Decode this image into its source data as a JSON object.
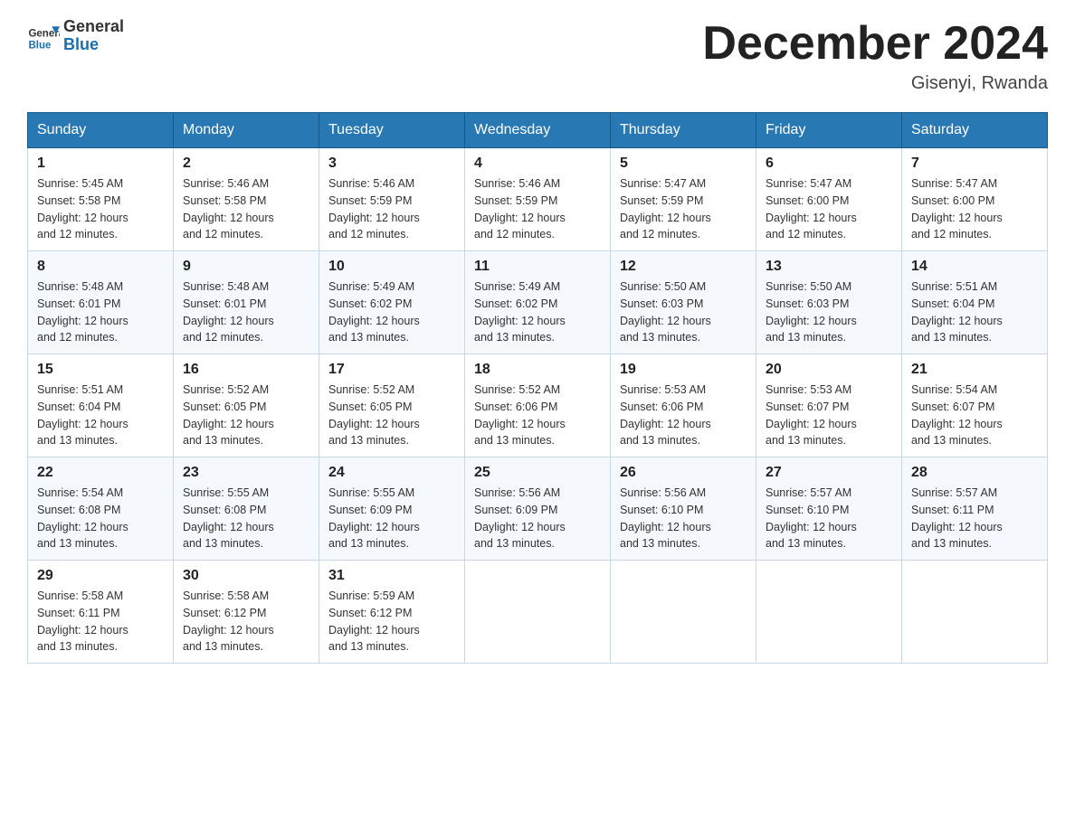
{
  "header": {
    "logo_general": "General",
    "logo_blue": "Blue",
    "month_title": "December 2024",
    "location": "Gisenyi, Rwanda"
  },
  "columns": [
    "Sunday",
    "Monday",
    "Tuesday",
    "Wednesday",
    "Thursday",
    "Friday",
    "Saturday"
  ],
  "weeks": [
    [
      {
        "day": "1",
        "info": "Sunrise: 5:45 AM\nSunset: 5:58 PM\nDaylight: 12 hours\nand 12 minutes."
      },
      {
        "day": "2",
        "info": "Sunrise: 5:46 AM\nSunset: 5:58 PM\nDaylight: 12 hours\nand 12 minutes."
      },
      {
        "day": "3",
        "info": "Sunrise: 5:46 AM\nSunset: 5:59 PM\nDaylight: 12 hours\nand 12 minutes."
      },
      {
        "day": "4",
        "info": "Sunrise: 5:46 AM\nSunset: 5:59 PM\nDaylight: 12 hours\nand 12 minutes."
      },
      {
        "day": "5",
        "info": "Sunrise: 5:47 AM\nSunset: 5:59 PM\nDaylight: 12 hours\nand 12 minutes."
      },
      {
        "day": "6",
        "info": "Sunrise: 5:47 AM\nSunset: 6:00 PM\nDaylight: 12 hours\nand 12 minutes."
      },
      {
        "day": "7",
        "info": "Sunrise: 5:47 AM\nSunset: 6:00 PM\nDaylight: 12 hours\nand 12 minutes."
      }
    ],
    [
      {
        "day": "8",
        "info": "Sunrise: 5:48 AM\nSunset: 6:01 PM\nDaylight: 12 hours\nand 12 minutes."
      },
      {
        "day": "9",
        "info": "Sunrise: 5:48 AM\nSunset: 6:01 PM\nDaylight: 12 hours\nand 12 minutes."
      },
      {
        "day": "10",
        "info": "Sunrise: 5:49 AM\nSunset: 6:02 PM\nDaylight: 12 hours\nand 13 minutes."
      },
      {
        "day": "11",
        "info": "Sunrise: 5:49 AM\nSunset: 6:02 PM\nDaylight: 12 hours\nand 13 minutes."
      },
      {
        "day": "12",
        "info": "Sunrise: 5:50 AM\nSunset: 6:03 PM\nDaylight: 12 hours\nand 13 minutes."
      },
      {
        "day": "13",
        "info": "Sunrise: 5:50 AM\nSunset: 6:03 PM\nDaylight: 12 hours\nand 13 minutes."
      },
      {
        "day": "14",
        "info": "Sunrise: 5:51 AM\nSunset: 6:04 PM\nDaylight: 12 hours\nand 13 minutes."
      }
    ],
    [
      {
        "day": "15",
        "info": "Sunrise: 5:51 AM\nSunset: 6:04 PM\nDaylight: 12 hours\nand 13 minutes."
      },
      {
        "day": "16",
        "info": "Sunrise: 5:52 AM\nSunset: 6:05 PM\nDaylight: 12 hours\nand 13 minutes."
      },
      {
        "day": "17",
        "info": "Sunrise: 5:52 AM\nSunset: 6:05 PM\nDaylight: 12 hours\nand 13 minutes."
      },
      {
        "day": "18",
        "info": "Sunrise: 5:52 AM\nSunset: 6:06 PM\nDaylight: 12 hours\nand 13 minutes."
      },
      {
        "day": "19",
        "info": "Sunrise: 5:53 AM\nSunset: 6:06 PM\nDaylight: 12 hours\nand 13 minutes."
      },
      {
        "day": "20",
        "info": "Sunrise: 5:53 AM\nSunset: 6:07 PM\nDaylight: 12 hours\nand 13 minutes."
      },
      {
        "day": "21",
        "info": "Sunrise: 5:54 AM\nSunset: 6:07 PM\nDaylight: 12 hours\nand 13 minutes."
      }
    ],
    [
      {
        "day": "22",
        "info": "Sunrise: 5:54 AM\nSunset: 6:08 PM\nDaylight: 12 hours\nand 13 minutes."
      },
      {
        "day": "23",
        "info": "Sunrise: 5:55 AM\nSunset: 6:08 PM\nDaylight: 12 hours\nand 13 minutes."
      },
      {
        "day": "24",
        "info": "Sunrise: 5:55 AM\nSunset: 6:09 PM\nDaylight: 12 hours\nand 13 minutes."
      },
      {
        "day": "25",
        "info": "Sunrise: 5:56 AM\nSunset: 6:09 PM\nDaylight: 12 hours\nand 13 minutes."
      },
      {
        "day": "26",
        "info": "Sunrise: 5:56 AM\nSunset: 6:10 PM\nDaylight: 12 hours\nand 13 minutes."
      },
      {
        "day": "27",
        "info": "Sunrise: 5:57 AM\nSunset: 6:10 PM\nDaylight: 12 hours\nand 13 minutes."
      },
      {
        "day": "28",
        "info": "Sunrise: 5:57 AM\nSunset: 6:11 PM\nDaylight: 12 hours\nand 13 minutes."
      }
    ],
    [
      {
        "day": "29",
        "info": "Sunrise: 5:58 AM\nSunset: 6:11 PM\nDaylight: 12 hours\nand 13 minutes."
      },
      {
        "day": "30",
        "info": "Sunrise: 5:58 AM\nSunset: 6:12 PM\nDaylight: 12 hours\nand 13 minutes."
      },
      {
        "day": "31",
        "info": "Sunrise: 5:59 AM\nSunset: 6:12 PM\nDaylight: 12 hours\nand 13 minutes."
      },
      null,
      null,
      null,
      null
    ]
  ]
}
